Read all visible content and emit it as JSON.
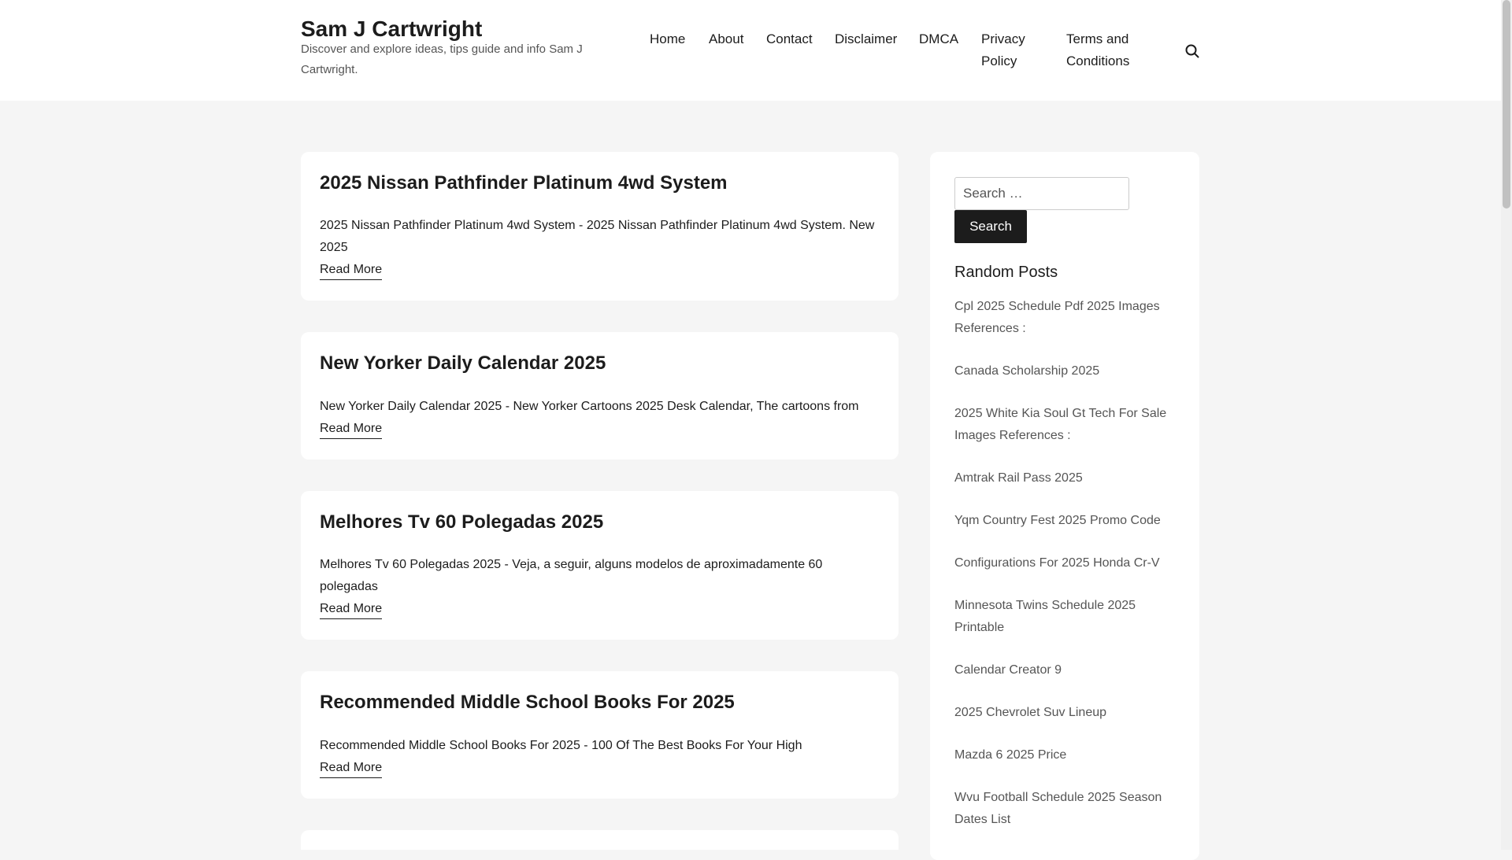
{
  "site": {
    "title": "Sam J Cartwright",
    "description": "Discover and explore ideas, tips guide and info Sam J Cartwright."
  },
  "nav": {
    "items": [
      "Home",
      "About",
      "Contact",
      "Disclaimer",
      "DMCA",
      "Privacy Policy",
      "Terms and Conditions"
    ],
    "search_icon": "search-icon"
  },
  "posts": [
    {
      "title": "2025 Nissan Pathfinder Platinum 4wd System",
      "excerpt": "2025 Nissan Pathfinder Platinum 4wd System - 2025 Nissan Pathfinder Platinum 4wd System. New 2025",
      "read_more": "Read More"
    },
    {
      "title": "New Yorker Daily Calendar 2025",
      "excerpt": "New Yorker Daily Calendar 2025 - New Yorker Cartoons 2025 Desk Calendar, The cartoons from",
      "read_more": "Read More"
    },
    {
      "title": "Melhores Tv 60 Polegadas 2025",
      "excerpt": "Melhores Tv 60 Polegadas 2025 - Veja, a seguir, alguns modelos de aproximadamente 60 polegadas",
      "read_more": "Read More"
    },
    {
      "title": "Recommended Middle School Books For 2025",
      "excerpt": "Recommended Middle School Books For 2025 - 100 Of The Best Books For Your High",
      "read_more": "Read More"
    }
  ],
  "sidebar": {
    "search_placeholder": "Search …",
    "search_button": "Search",
    "random_posts_title": "Random Posts",
    "random_posts": [
      "Cpl 2025 Schedule Pdf 2025 Images References :",
      "Canada Scholarship 2025",
      "2025 White Kia Soul Gt Tech For Sale Images References :",
      "Amtrak Rail Pass 2025",
      "Yqm Country Fest 2025 Promo Code",
      "Configurations For 2025 Honda Cr-V",
      "Minnesota Twins Schedule 2025 Printable",
      "Calendar Creator 9",
      "2025 Chevrolet Suv Lineup",
      "Mazda 6 2025 Price",
      "Wvu Football Schedule 2025 Season Dates List"
    ]
  },
  "colors": {
    "page_bg": "#f5f5f5",
    "card_bg": "#ffffff",
    "text": "#1c1c1c",
    "muted": "#555555",
    "button_bg": "#1c1c1c"
  }
}
